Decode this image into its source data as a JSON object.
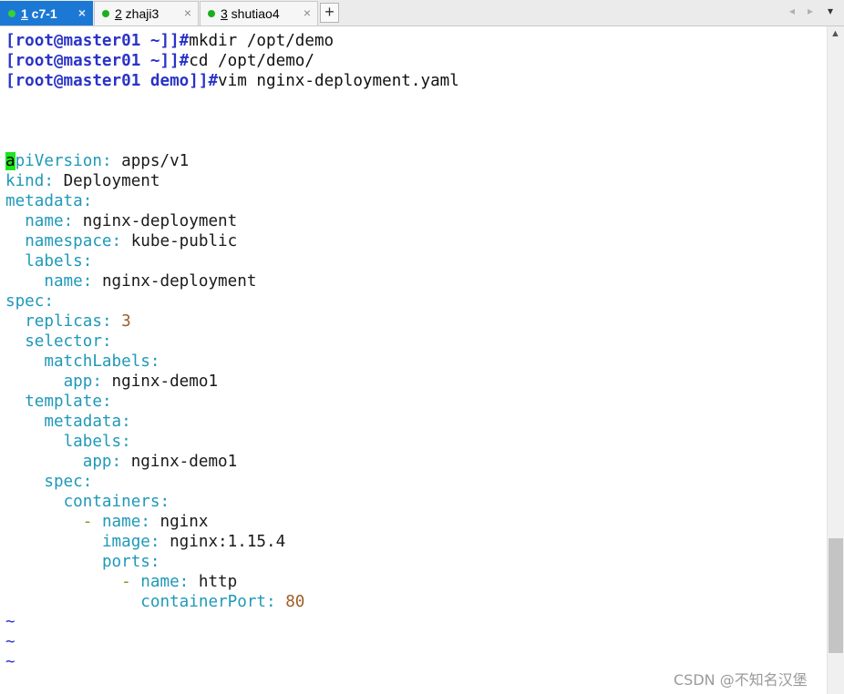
{
  "tabs": [
    {
      "number": "1",
      "name": " c7-1",
      "active": true,
      "close": "×"
    },
    {
      "number": "2",
      "name": " zhaji3",
      "active": false,
      "close": "×"
    },
    {
      "number": "3",
      "name": " shutiao4",
      "active": false,
      "close": "×"
    }
  ],
  "new_tab_label": "+",
  "tab_nav": {
    "prev": "◂",
    "next": "▸",
    "menu": "▾"
  },
  "shell": [
    {
      "prompt": "[root@master01 ~]]#",
      "command": "mkdir /opt/demo"
    },
    {
      "prompt": "[root@master01 ~]]#",
      "command": "cd /opt/demo/"
    },
    {
      "prompt": "[root@master01 demo]]#",
      "command": "vim nginx-deployment.yaml"
    }
  ],
  "yaml": {
    "apiVersion_cursor": "a",
    "apiVersion_rest": "piVersion",
    "apiVersion": "apps/v1",
    "kind_key": "kind",
    "kind": "Deployment",
    "metadata_key": "metadata",
    "name_key": "name",
    "metadata_name": "nginx-deployment",
    "namespace_key": "namespace",
    "namespace": "kube-public",
    "labels_key": "labels",
    "labels_name": "nginx-deployment",
    "spec_key": "spec",
    "replicas_key": "replicas",
    "replicas": "3",
    "selector_key": "selector",
    "matchLabels_key": "matchLabels",
    "app_key": "app",
    "selector_app": "nginx-demo1",
    "template_key": "template",
    "template_app": "nginx-demo1",
    "containers_key": "containers",
    "container_name": "nginx",
    "image_key": "image",
    "image": "nginx:1.15.4",
    "ports_key": "ports",
    "port_name": "http",
    "containerPort_key": "containerPort",
    "containerPort": "80"
  },
  "colon": ":",
  "dash": "-",
  "empty_line_marker": "~",
  "scroll_up": "▲",
  "watermark": "CSDN @不知名汉堡",
  "colors": {
    "prompt": "#2a33c8",
    "key": "#1f99b8",
    "number": "#a15d26",
    "cursor": "#1ee61e",
    "active_tab": "#1b78d4"
  }
}
